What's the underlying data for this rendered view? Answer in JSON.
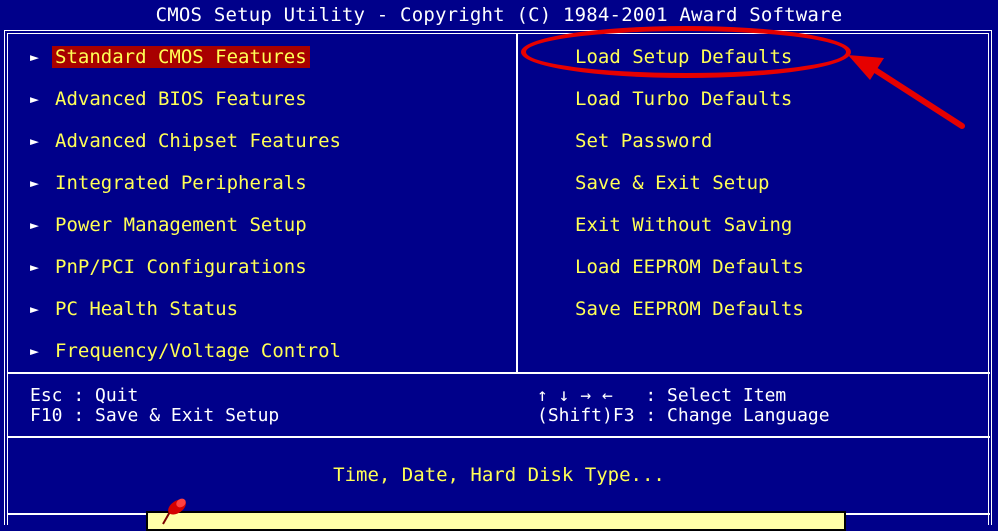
{
  "title": "CMOS Setup Utility - Copyright (C) 1984-2001 Award Software",
  "left_menu": [
    {
      "label": "Standard CMOS Features",
      "selected": true
    },
    {
      "label": "Advanced BIOS Features"
    },
    {
      "label": "Advanced Chipset Features"
    },
    {
      "label": "Integrated Peripherals"
    },
    {
      "label": "Power Management Setup"
    },
    {
      "label": "PnP/PCI Configurations"
    },
    {
      "label": "PC Health Status"
    },
    {
      "label": "Frequency/Voltage Control"
    }
  ],
  "right_menu": [
    {
      "label": "Load Setup Defaults"
    },
    {
      "label": "Load Turbo Defaults"
    },
    {
      "label": "Set Password"
    },
    {
      "label": "Save & Exit Setup"
    },
    {
      "label": "Exit Without Saving"
    },
    {
      "label": "Load EEPROM Defaults"
    },
    {
      "label": "Save EEPROM Defaults"
    }
  ],
  "help": {
    "esc": "Esc : Quit",
    "f10": "F10 : Save & Exit Setup",
    "select": "↑ ↓ → ←   : Select Item",
    "lang": "(Shift)F3 : Change Language"
  },
  "status_text": "Time, Date, Hard Disk Type...",
  "arrow_glyph": "►",
  "colors": {
    "background": "#00008a",
    "menu_text": "#ffff55",
    "highlight": "#a80000",
    "annotation": "#e60000"
  }
}
